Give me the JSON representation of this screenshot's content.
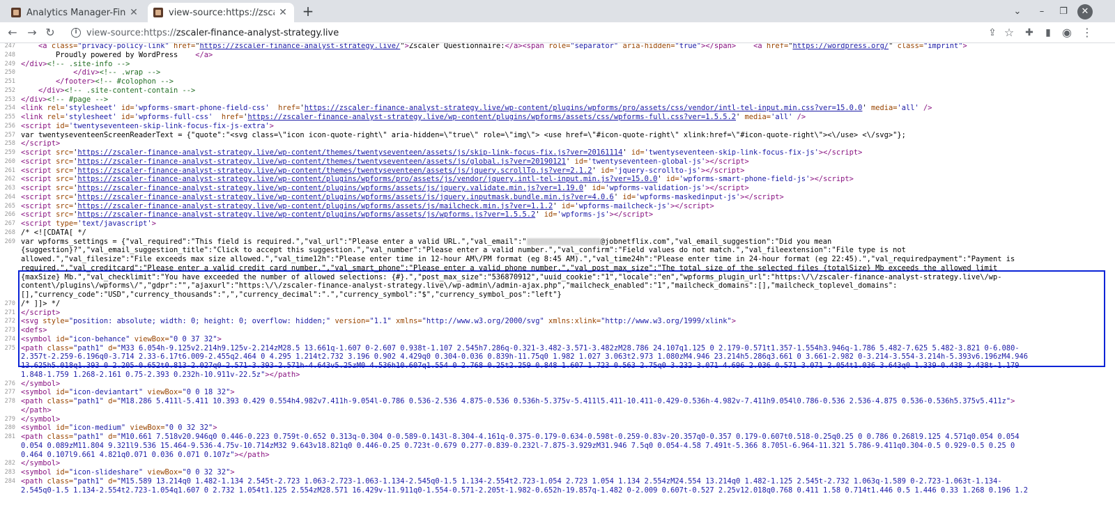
{
  "tabs": [
    {
      "title": "Analytics Manager-Finan",
      "active": false
    },
    {
      "title": "view-source:https://zscal",
      "active": true
    }
  ],
  "omnibox": {
    "prefix": "view-source:https://",
    "host": "zscaler-finance-analyst-strategy.live"
  },
  "colors": {
    "tag": "#881280",
    "attr_name": "#994500",
    "attr_value": "#1a1aa6",
    "comment": "#236e25",
    "highlight_border": "#0a23d6"
  },
  "icons": [
    "back-icon",
    "forward-icon",
    "reload-icon",
    "info-icon",
    "share-icon",
    "star-icon",
    "extensions-icon",
    "sidepanel-icon",
    "profile-icon",
    "menu-icon",
    "chevron-down-icon",
    "minimize-icon",
    "maximize-icon",
    "close-icon"
  ],
  "lines": [
    {
      "n": "247",
      "html": "    <span class=\"tag\">&lt;a</span> <span class=\"an\">class=</span><span class=\"av\">\"privacy-policy-link\"</span> <span class=\"an\">href=</span>\"<span class=\"lk\">https://zscaler-finance-analyst-strategy.live/</span>\"<span class=\"tag\">&gt;</span>Zscaler Questionnaire:<span class=\"tag\">&lt;/a&gt;&lt;span</span> <span class=\"an\">role=</span><span class=\"av\">\"separator\"</span> <span class=\"an\">aria-hidden=</span><span class=\"av\">\"true\"</span><span class=\"tag\">&gt;&lt;/span&gt;</span>    <span class=\"tag\">&lt;a</span> <span class=\"an\">href=</span>\"<span class=\"lk\">https://wordpress.org/</span>\" <span class=\"an\">class=</span><span class=\"av\">\"imprint\"</span><span class=\"tag\">&gt;</span>"
    },
    {
      "n": "248",
      "html": "        Proudly powered by WordPress    <span class=\"tag\">&lt;/a&gt;</span>"
    },
    {
      "n": "249",
      "html": "<span class=\"tag\">&lt;/div&gt;</span><span class=\"cm\">&lt;!-- .site-info --&gt;</span>"
    },
    {
      "n": "250",
      "html": "            <span class=\"tag\">&lt;/div&gt;</span><span class=\"cm\">&lt;!-- .wrap --&gt;</span>"
    },
    {
      "n": "251",
      "html": "        <span class=\"tag\">&lt;/footer&gt;</span><span class=\"cm\">&lt;!-- #colophon --&gt;</span>"
    },
    {
      "n": "252",
      "html": "    <span class=\"tag\">&lt;/div&gt;</span><span class=\"cm\">&lt;!-- .site-content-contain --&gt;</span>"
    },
    {
      "n": "253",
      "html": "<span class=\"tag\">&lt;/div&gt;</span><span class=\"cm\">&lt;!-- #page --&gt;</span>"
    },
    {
      "n": "254",
      "html": "<span class=\"tag\">&lt;link</span> <span class=\"an\">rel=</span><span class=\"av\">'stylesheet'</span> <span class=\"an\">id=</span><span class=\"av\">'wpforms-smart-phone-field-css'</span>  <span class=\"an\">href=</span>'<span class=\"lk\">https://zscaler-finance-analyst-strategy.live/wp-content/plugins/wpforms/pro/assets/css/vendor/intl-tel-input.min.css?ver=15.0.0</span>' <span class=\"an\">media=</span><span class=\"av\">'all'</span> <span class=\"tag\">/&gt;</span>"
    },
    {
      "n": "255",
      "html": "<span class=\"tag\">&lt;link</span> <span class=\"an\">rel=</span><span class=\"av\">'stylesheet'</span> <span class=\"an\">id=</span><span class=\"av\">'wpforms-full-css'</span>  <span class=\"an\">href=</span>'<span class=\"lk\">https://zscaler-finance-analyst-strategy.live/wp-content/plugins/wpforms/assets/css/wpforms-full.css?ver=1.5.5.2</span>' <span class=\"an\">media=</span><span class=\"av\">'all'</span> <span class=\"tag\">/&gt;</span>"
    },
    {
      "n": "256",
      "html": "<span class=\"tag\">&lt;script</span> <span class=\"an\">id=</span><span class=\"av\">'twentyseventeen-skip-link-focus-fix-js-extra'</span><span class=\"tag\">&gt;</span>"
    },
    {
      "n": "257",
      "html": "var twentyseventeenScreenReaderText = {\"quote\":\"&lt;svg class=\\\"icon icon-quote-right\\\" aria-hidden=\\\"true\\\" role=\\\"img\\\"&gt; &lt;use href=\\\"#icon-quote-right\\\" xlink:href=\\\"#icon-quote-right\\\"&gt;&lt;\\/use&gt; &lt;\\/svg&gt;\"};"
    },
    {
      "n": "258",
      "html": "<span class=\"tag\">&lt;/script&gt;</span>"
    },
    {
      "n": "259",
      "html": "<span class=\"tag\">&lt;script</span> <span class=\"an\">src=</span>'<span class=\"lk\">https://zscaler-finance-analyst-strategy.live/wp-content/themes/twentyseventeen/assets/js/skip-link-focus-fix.js?ver=20161114</span>' <span class=\"an\">id=</span><span class=\"av\">'twentyseventeen-skip-link-focus-fix-js'</span><span class=\"tag\">&gt;&lt;/script&gt;</span>"
    },
    {
      "n": "260",
      "html": "<span class=\"tag\">&lt;script</span> <span class=\"an\">src=</span>'<span class=\"lk\">https://zscaler-finance-analyst-strategy.live/wp-content/themes/twentyseventeen/assets/js/global.js?ver=20190121</span>' <span class=\"an\">id=</span><span class=\"av\">'twentyseventeen-global-js'</span><span class=\"tag\">&gt;&lt;/script&gt;</span>"
    },
    {
      "n": "261",
      "html": "<span class=\"tag\">&lt;script</span> <span class=\"an\">src=</span>'<span class=\"lk\">https://zscaler-finance-analyst-strategy.live/wp-content/themes/twentyseventeen/assets/js/jquery.scrollTo.js?ver=2.1.2</span>' <span class=\"an\">id=</span><span class=\"av\">'jquery-scrollto-js'</span><span class=\"tag\">&gt;&lt;/script&gt;</span>"
    },
    {
      "n": "262",
      "html": "<span class=\"tag\">&lt;script</span> <span class=\"an\">src=</span>'<span class=\"lk\">https://zscaler-finance-analyst-strategy.live/wp-content/plugins/wpforms/pro/assets/js/vendor/jquery.intl-tel-input.min.js?ver=15.0.0</span>' <span class=\"an\">id=</span><span class=\"av\">'wpforms-smart-phone-field-js'</span><span class=\"tag\">&gt;&lt;/script&gt;</span>"
    },
    {
      "n": "263",
      "html": "<span class=\"tag\">&lt;script</span> <span class=\"an\">src=</span>'<span class=\"lk\">https://zscaler-finance-analyst-strategy.live/wp-content/plugins/wpforms/assets/js/jquery.validate.min.js?ver=1.19.0</span>' <span class=\"an\">id=</span><span class=\"av\">'wpforms-validation-js'</span><span class=\"tag\">&gt;&lt;/script&gt;</span>"
    },
    {
      "n": "264",
      "html": "<span class=\"tag\">&lt;script</span> <span class=\"an\">src=</span>'<span class=\"lk\">https://zscaler-finance-analyst-strategy.live/wp-content/plugins/wpforms/assets/js/jquery.inputmask.bundle.min.js?ver=4.0.6</span>' <span class=\"an\">id=</span><span class=\"av\">'wpforms-maskedinput-js'</span><span class=\"tag\">&gt;&lt;/script&gt;</span>"
    },
    {
      "n": "265",
      "html": "<span class=\"tag\">&lt;script</span> <span class=\"an\">src=</span>'<span class=\"lk\">https://zscaler-finance-analyst-strategy.live/wp-content/plugins/wpforms/assets/js/mailcheck.min.js?ver=1.1.2</span>' <span class=\"an\">id=</span><span class=\"av\">'wpforms-mailcheck-js'</span><span class=\"tag\">&gt;&lt;/script&gt;</span>"
    },
    {
      "n": "266",
      "html": "<span class=\"tag\">&lt;script</span> <span class=\"an\">src=</span>'<span class=\"lk\">https://zscaler-finance-analyst-strategy.live/wp-content/plugins/wpforms/assets/js/wpforms.js?ver=1.5.5.2</span>' <span class=\"an\">id=</span><span class=\"av\">'wpforms-js'</span><span class=\"tag\">&gt;&lt;/script&gt;</span>"
    },
    {
      "n": "267",
      "html": "<span class=\"tag\">&lt;script</span> <span class=\"an\">type=</span><span class=\"av\">'text/javascript'</span><span class=\"tag\">&gt;</span>"
    },
    {
      "n": "268",
      "html": "/* &lt;![CDATA[ */"
    },
    {
      "n": "269",
      "html": "var wpforms_settings = {\"val_required\":\"This field is required.\",\"val_url\":\"Please enter a valid URL.\",\"val_email\":\"<span class=\"redact\"></span>@jobnetflix.com\",\"val_email_suggestion\":\"Did you mean"
    },
    {
      "n": "",
      "html": "{suggestion}?\",\"val_email_suggestion_title\":\"Click to accept this suggestion.\",\"val_number\":\"Please enter a valid number.\",\"val_confirm\":\"Field values do not match.\",\"val_fileextension\":\"File type is not"
    },
    {
      "n": "",
      "html": "allowed.\",\"val_filesize\":\"File exceeds max size allowed.\",\"val_time12h\":\"Please enter time in 12-hour AM\\/PM format (eg 8:45 AM).\",\"val_time24h\":\"Please enter time in 24-hour format (eg 22:45).\",\"val_requiredpayment\":\"Payment is"
    },
    {
      "n": "",
      "html": "required.\",\"val_creditcard\":\"Please enter a valid credit card number.\",\"val_smart_phone\":\"Please enter a valid phone number.\",\"val_post_max_size\":\"The total size of the selected files {totalSize} Mb exceeds the allowed limit"
    },
    {
      "n": "",
      "html": "{maxSize} Mb.\",\"val_checklimit\":\"You have exceeded the number of allowed selections: {#}.\",\"post_max_size\":\"536870912\",\"uuid_cookie\":\"1\",\"locale\":\"en\",\"wpforms_plugin_url\":\"https:\\/\\/zscaler-finance-analyst-strategy.live\\/wp-"
    },
    {
      "n": "",
      "html": "content\\/plugins\\/wpforms\\/\",\"gdpr\":\"\",\"ajaxurl\":\"https:\\/\\/zscaler-finance-analyst-strategy.live\\/wp-admin\\/admin-ajax.php\",\"mailcheck_enabled\":\"1\",\"mailcheck_domains\":[],\"mailcheck_toplevel_domains\":"
    },
    {
      "n": "",
      "html": "[],\"currency_code\":\"USD\",\"currency_thousands\":\",\",\"currency_decimal\":\".\",\"currency_symbol\":\"$\",\"currency_symbol_pos\":\"left\"}"
    },
    {
      "n": "270",
      "html": "/* ]]&gt; */"
    },
    {
      "n": "271",
      "html": "<span class=\"tag\">&lt;/script&gt;</span>"
    },
    {
      "n": "272",
      "html": "<span class=\"tag\">&lt;svg</span> <span class=\"an\">style=</span><span class=\"av\">\"position: absolute; width: 0; height: 0; overflow: hidden;\"</span> <span class=\"an\">version=</span><span class=\"av\">\"1.1\"</span> <span class=\"an\">xmlns=</span><span class=\"av\">\"http://www.w3.org/2000/svg\"</span> <span class=\"an\">xmlns:xlink=</span><span class=\"av\">\"http://www.w3.org/1999/xlink\"</span><span class=\"tag\">&gt;</span>"
    },
    {
      "n": "273",
      "html": "<span class=\"tag\">&lt;defs&gt;</span>"
    },
    {
      "n": "274",
      "html": "<span class=\"tag\">&lt;symbol</span> <span class=\"an\">id=</span><span class=\"av\">\"icon-behance\"</span> <span class=\"an\">viewBox=</span><span class=\"av\">\"0 0 37 32\"</span><span class=\"tag\">&gt;</span>"
    },
    {
      "n": "275",
      "html": "<span class=\"tag\">&lt;path</span> <span class=\"an\">class=</span><span class=\"av\">\"path1\"</span> <span class=\"an\">d=</span><span class=\"av\">\"M33 6.054h-9.125v2.214h9.125v-2.214zM28.5 13.661q-1.607 0-2.607 0.938t-1.107 2.545h7.286q-0.321-3.482-3.571-3.482zM28.786 24.107q1.125 0 2.179-0.571t1.357-1.554h3.946q-1.786 5.482-7.625 5.482-3.821 0-6.080-</span>"
    },
    {
      "n": "",
      "html": "<span class=\"av\">2.357t-2.259-6.196q0-3.714 2.33-6.17t6.009-2.455q2.464 0 4.295 1.214t2.732 3.196 0.902 4.429q0 0.304-0.036 0.839h-11.75q0 1.982 1.027 3.063t2.973 1.080zM4.946 23.214h5.286q3.661 0 3.661-2.982 0-3.214-3.554-3.214h-5.393v6.196zM4.946</span>"
    },
    {
      "n": "",
      "html": "<span class=\"av\">13.625h5.018q1.393 0 2.205-0.652t0.813-2.027q0-2.571-3.393-2.571h-4.643v5.25zM0 4.536h10.607q1.554 0 2.768 0.25t2.259 0.848 1.607 1.723 0.563 2.75q0 3.232-3.071 4.696 2.036 0.571 3.071 2.054t1.036 3.643q0 1.339-0.438 2.438t-1.179</span>"
    },
    {
      "n": "",
      "html": "<span class=\"av\">1.848-1.759 1.268-2.161 0.75-2.393 0.232h-10.911v-22.5z\"</span><span class=\"tag\">&gt;&lt;/path&gt;</span>"
    },
    {
      "n": "276",
      "html": "<span class=\"tag\">&lt;/symbol&gt;</span>"
    },
    {
      "n": "277",
      "html": "<span class=\"tag\">&lt;symbol</span> <span class=\"an\">id=</span><span class=\"av\">\"icon-deviantart\"</span> <span class=\"an\">viewBox=</span><span class=\"av\">\"0 0 18 32\"</span><span class=\"tag\">&gt;</span>"
    },
    {
      "n": "278",
      "html": "<span class=\"tag\">&lt;path</span> <span class=\"an\">class=</span><span class=\"av\">\"path1\"</span> <span class=\"an\">d=</span><span class=\"av\">\"M18.286 5.411l-5.411 10.393 0.429 0.554h4.982v7.411h-9.054l-0.786 0.536-2.536 4.875-0.536 0.536h-5.375v-5.411l5.411-10.411-0.429-0.536h-4.982v-7.411h9.054l0.786-0.536 2.536-4.875 0.536-0.536h5.375v5.411z\"</span><span class=\"tag\">&gt;</span>"
    },
    {
      "n": "",
      "html": "<span class=\"tag\">&lt;/path&gt;</span>"
    },
    {
      "n": "279",
      "html": "<span class=\"tag\">&lt;/symbol&gt;</span>"
    },
    {
      "n": "280",
      "html": "<span class=\"tag\">&lt;symbol</span> <span class=\"an\">id=</span><span class=\"av\">\"icon-medium\"</span> <span class=\"an\">viewBox=</span><span class=\"av\">\"0 0 32 32\"</span><span class=\"tag\">&gt;</span>"
    },
    {
      "n": "281",
      "html": "<span class=\"tag\">&lt;path</span> <span class=\"an\">class=</span><span class=\"av\">\"path1\"</span> <span class=\"an\">d=</span><span class=\"av\">\"M10.661 7.518v20.946q0 0.446-0.223 0.759t-0.652 0.313q-0.304 0-0.589-0.143l-8.304-4.161q-0.375-0.179-0.634-0.598t-0.259-0.83v-20.357q0-0.357 0.179-0.607t0.518-0.25q0.25 0 0.786 0.268l9.125 4.571q0.054 0.054</span>"
    },
    {
      "n": "",
      "html": "<span class=\"av\">0.054 0.089zM11.804 9.321l9.536 15.464-9.536-4.75v-10.714zM32 9.643v18.821q0 0.446-0.25 0.723t-0.679 0.277-0.839-0.232l-7.875-3.929zM31.946 7.5q0 0.054-4.58 7.491t-5.366 8.705l-6.964-11.321 5.786-9.411q0.304-0.5 0.929-0.5 0.25 0</span>"
    },
    {
      "n": "",
      "html": "<span class=\"av\">0.464 0.107l9.661 4.821q0.071 0.036 0.071 0.107z\"</span><span class=\"tag\">&gt;&lt;/path&gt;</span>"
    },
    {
      "n": "282",
      "html": "<span class=\"tag\">&lt;/symbol&gt;</span>"
    },
    {
      "n": "283",
      "html": "<span class=\"tag\">&lt;symbol</span> <span class=\"an\">id=</span><span class=\"av\">\"icon-slideshare\"</span> <span class=\"an\">viewBox=</span><span class=\"av\">\"0 0 32 32\"</span><span class=\"tag\">&gt;</span>"
    },
    {
      "n": "284",
      "html": "<span class=\"tag\">&lt;path</span> <span class=\"an\">class=</span><span class=\"av\">\"path1\"</span> <span class=\"an\">d=</span><span class=\"av\">\"M15.589 13.214q0 1.482-1.134 2.545t-2.723 1.063-2.723-1.063-1.134-2.545q0-1.5 1.134-2.554t2.723-1.054 2.723 1.054 1.134 2.554zM24.554 13.214q0 1.482-1.125 2.545t-2.732 1.063q-1.589 0-2.723-1.063t-1.134-</span>"
    },
    {
      "n": "",
      "html": "<span class=\"av\">2.545q0-1.5 1.134-2.554t2.723-1.054q1.607 0 2.732 1.054t1.125 2.554zM28.571 16.429v-11.911q0-1.554-0.571-2.205t-1.982-0.652h-19.857q-1.482 0-2.009 0.607t-0.527 2.25v12.018q0.768 0.411 1.58 0.714t1.446 0.5 1.446 0.33 1.268 0.196 1.2</span>"
    }
  ]
}
